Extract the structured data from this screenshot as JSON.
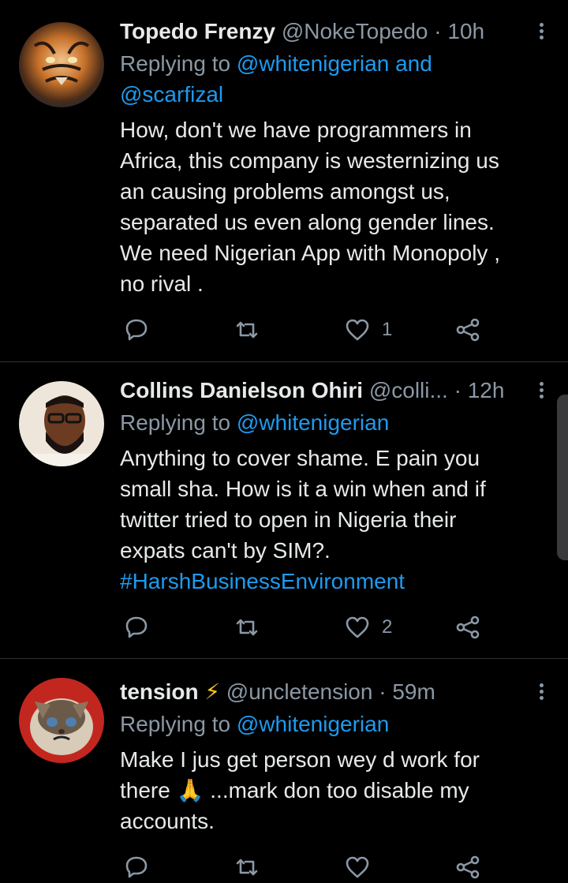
{
  "tweets": [
    {
      "name": "Topedo Frenzy",
      "handle": "@NokeTopedo",
      "time": "10h",
      "replying_prefix": "Replying to",
      "replying_line1": "@whitenigerian and",
      "replying_line2": "@scarfizal",
      "body_lines": [
        "How, don't we have programmers in",
        "Africa, this company is westernizing us",
        "an causing problems amongst us,",
        "separated us even along gender lines.",
        "We need Nigerian App with Monopoly ,",
        "no rival ."
      ],
      "likes": "1"
    },
    {
      "name": "Collins Danielson Ohiri",
      "handle": "@colli...",
      "time": "12h",
      "replying_prefix": "Replying to",
      "replying_line1": "@whitenigerian",
      "body_lines": [
        "Anything to cover shame. E pain you",
        "small sha. How is it a win when and if",
        "twitter tried to open in Nigeria their",
        "expats can't by SIM?."
      ],
      "hashtag": "#HarshBusinessEnvironment",
      "likes": "2"
    },
    {
      "name": "tension",
      "name_emoji": "⚡",
      "handle": "@uncletension",
      "time": "59m",
      "replying_prefix": "Replying to",
      "replying_line1": "@whitenigerian",
      "body_line1_a": "Make I jus get person wey d work for",
      "body_line2_a": "there",
      "body_line2_emoji": "🙏",
      "body_line2_b": "...mark don too disable my",
      "body_line3": "accounts."
    }
  ],
  "separator": "·",
  "colors": {
    "background": "#000000",
    "text": "#e7e9ea",
    "secondary": "#8b98a5",
    "link": "#1d9bf0",
    "divider": "#2f3336"
  },
  "icons": [
    "reply-icon",
    "retweet-icon",
    "like-icon",
    "share-icon",
    "more-icon"
  ]
}
